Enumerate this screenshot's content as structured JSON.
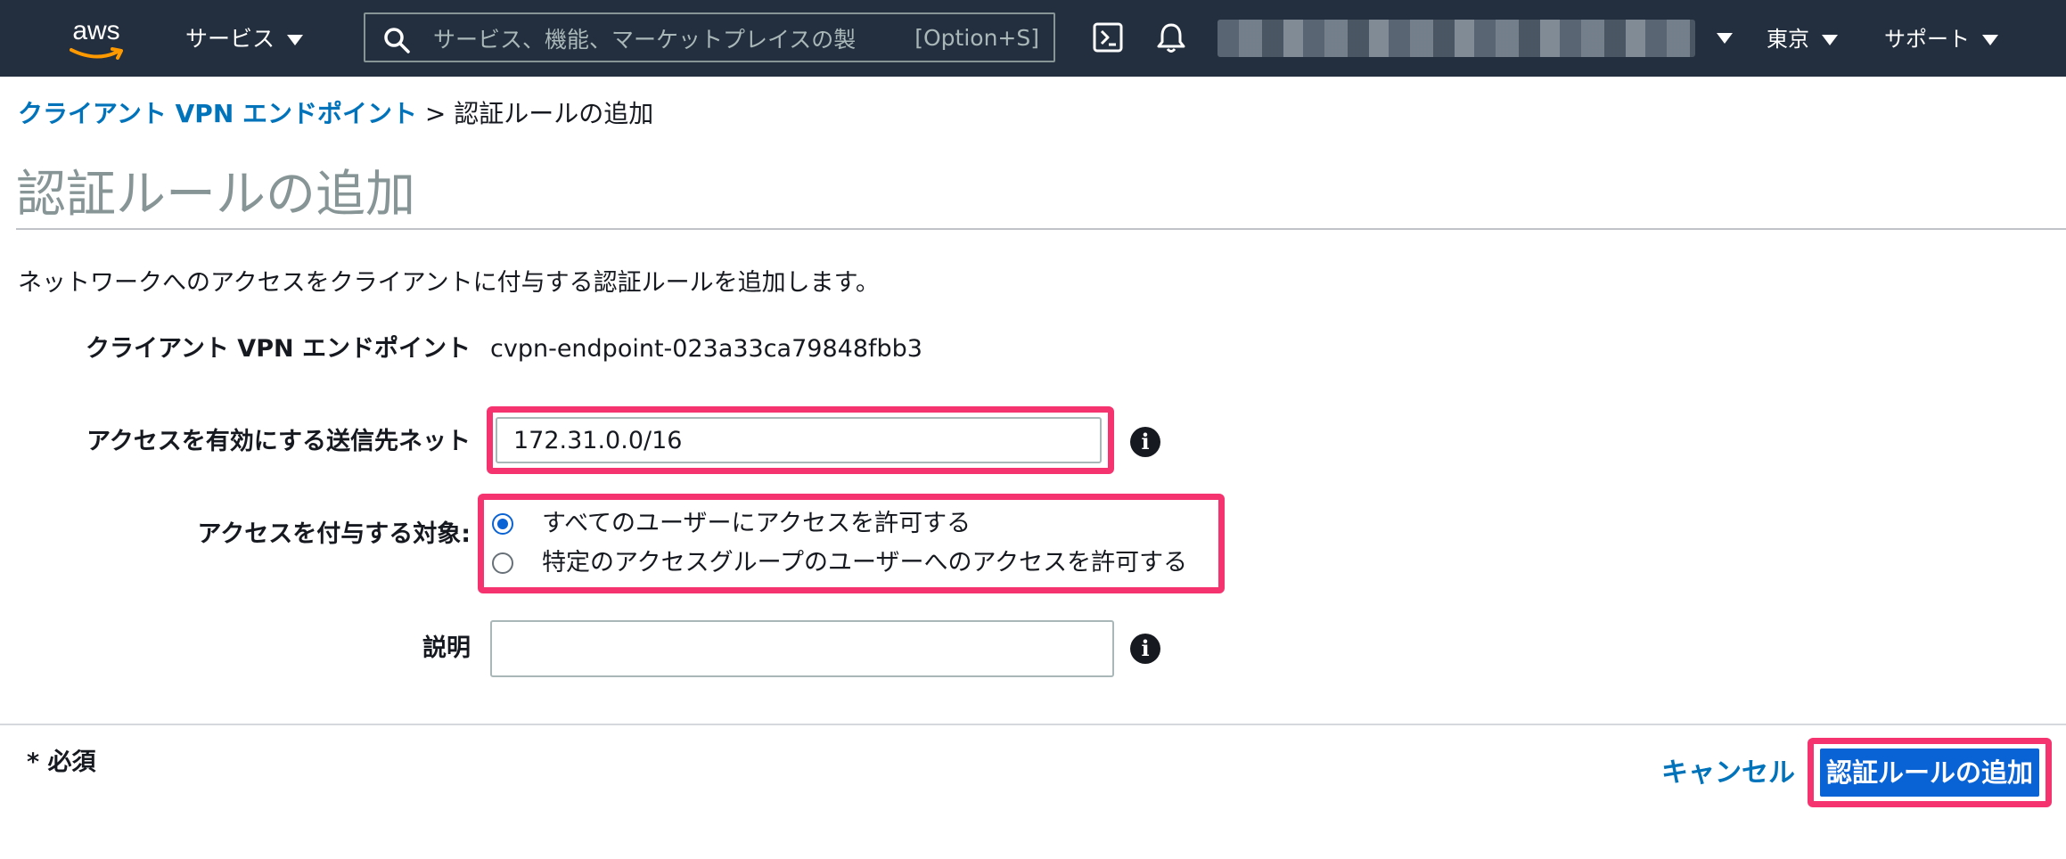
{
  "nav": {
    "logo_text": "aws",
    "services_label": "サービス",
    "search_placeholder": "サービス、機能、マーケットプレイスの製",
    "search_shortcut": "[Option+S]",
    "region_label": "東京",
    "support_label": "サポート"
  },
  "breadcrumb": {
    "parent_link": "クライアント VPN エンドポイント",
    "separator": ">",
    "current": "認証ルールの追加"
  },
  "page": {
    "title": "認証ルールの追加",
    "description": "ネットワークへのアクセスをクライアントに付与する認証ルールを追加します。"
  },
  "form": {
    "endpoint_label": "クライアント VPN エンドポイント",
    "endpoint_value": "cvpn-endpoint-023a33ca79848fbb3",
    "destination_label": "アクセスを有効にする送信先ネット",
    "destination_value": "172.31.0.0/16",
    "grant_label": "アクセスを付与する対象:",
    "grant_options": [
      {
        "label": "すべてのユーザーにアクセスを許可する",
        "checked": true
      },
      {
        "label": "特定のアクセスグループのユーザーへのアクセスを許可する",
        "checked": false
      }
    ],
    "description_label": "説明",
    "description_value": ""
  },
  "footer": {
    "required_note": "* 必須",
    "cancel_label": "キャンセル",
    "submit_label": "認証ルールの追加"
  },
  "colors": {
    "nav_bg": "#232f3e",
    "link": "#0073bb",
    "primary": "#0a63d4",
    "highlight": "#f5336f"
  },
  "icons": {
    "search": "search-icon",
    "cloudshell": "cloudshell-icon",
    "bell": "bell-icon",
    "info": "info-icon",
    "caret": "caret-down-icon"
  }
}
